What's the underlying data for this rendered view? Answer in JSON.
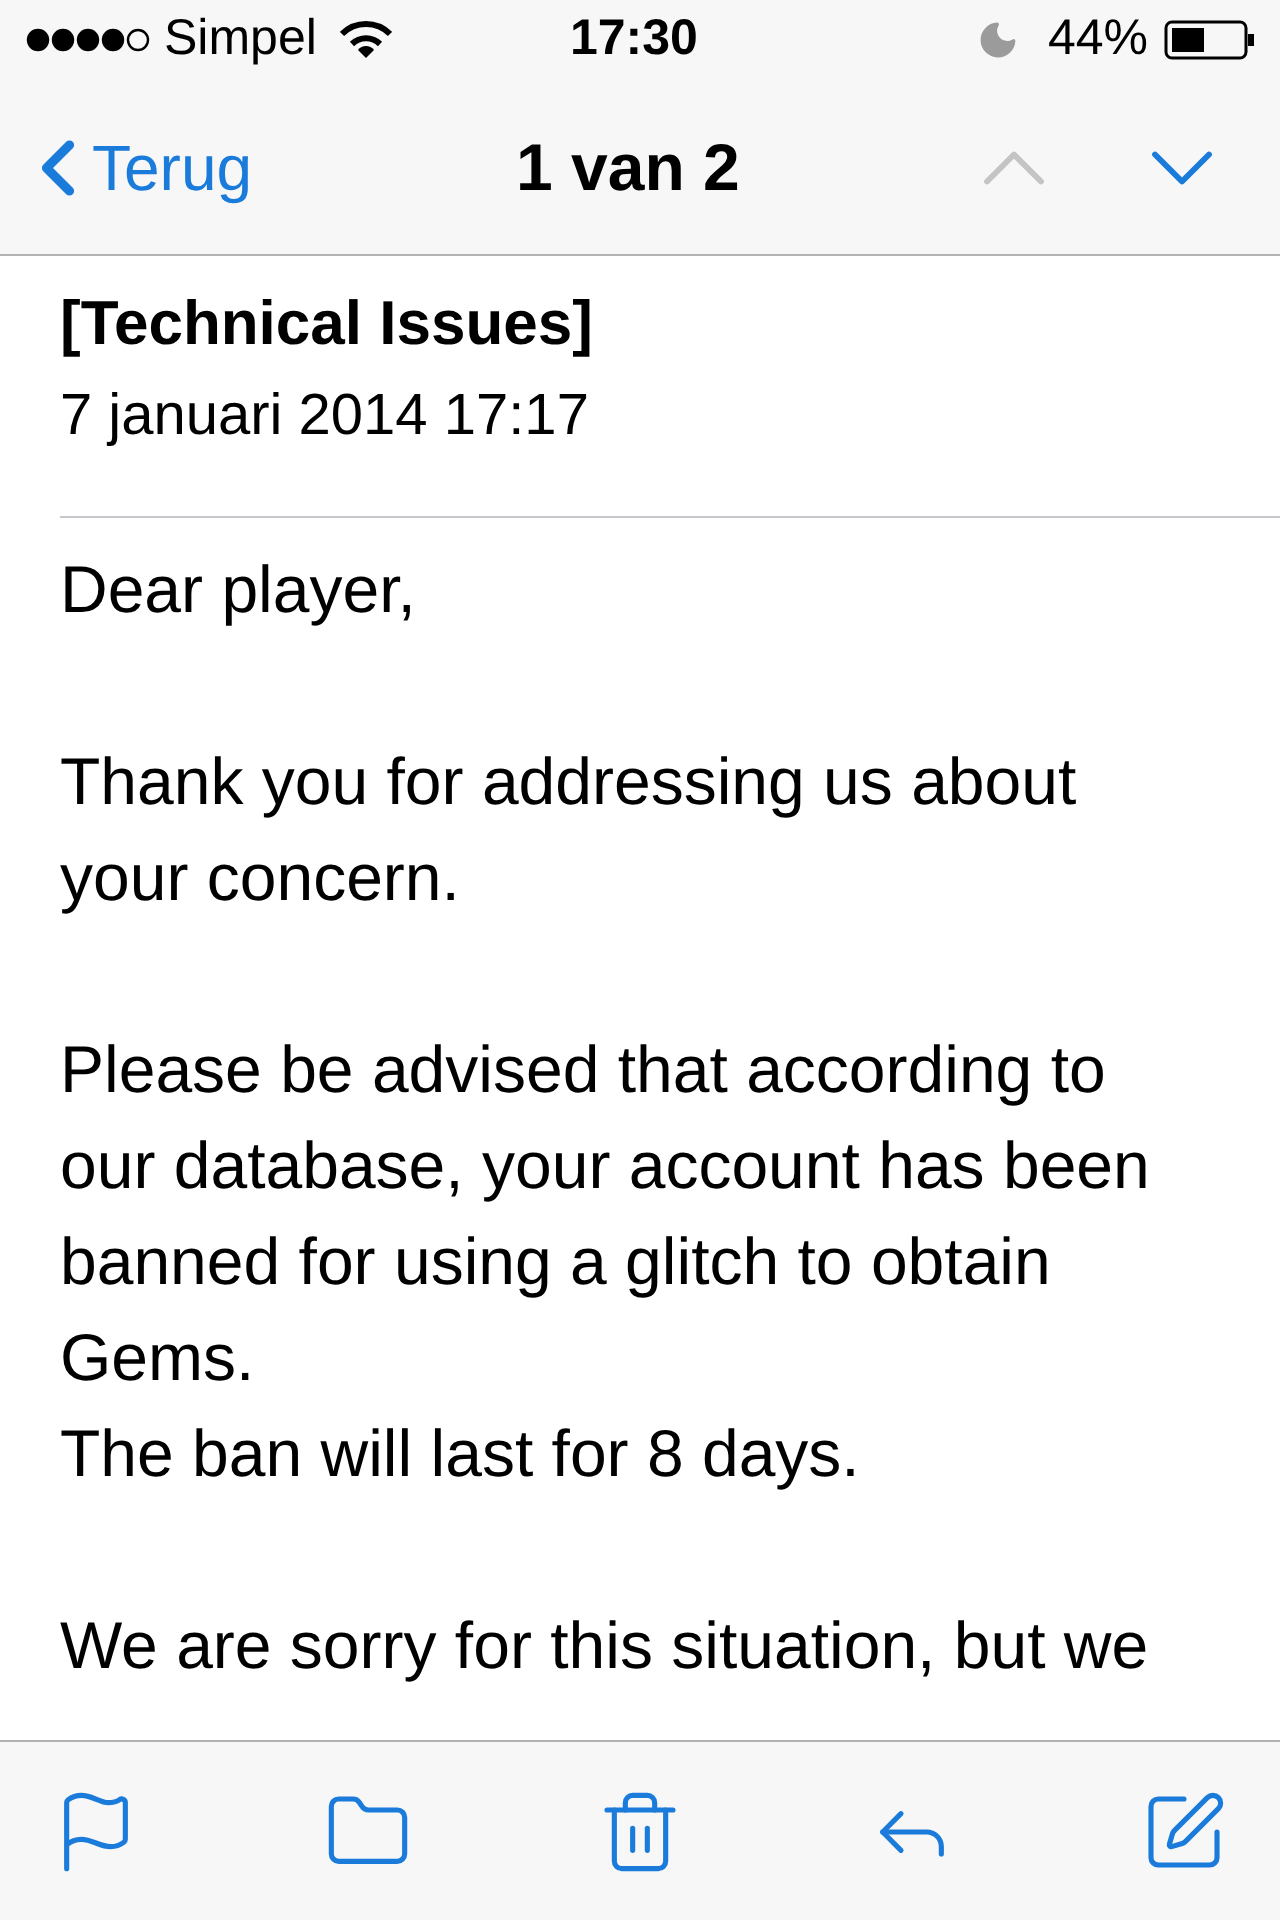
{
  "status_bar": {
    "carrier": "Simpel",
    "time": "17:30",
    "battery": "44%"
  },
  "nav": {
    "back": "Terug",
    "title": "1 van 2",
    "buttons": [
      {
        "kind": "up",
        "disabled": true
      },
      {
        "kind": "down",
        "disabled": false
      }
    ]
  },
  "message": {
    "subject": "[Technical Issues]",
    "date": "7 januari 2014 17:17",
    "paragraphs": [
      [
        "Dear player,"
      ],
      [
        "Thank you for addressing us about your concern."
      ],
      [
        "Please be advised that according to our database, your account has been banned for using a glitch to obtain Gems.",
        "The ban will last for 8 days."
      ],
      [
        "We are sorry for this situation, but we"
      ]
    ]
  },
  "toolbar": {
    "buttons": [
      {
        "kind": "flag"
      },
      {
        "kind": "folder"
      },
      {
        "kind": "trash"
      },
      {
        "kind": "reply"
      },
      {
        "kind": "compose"
      }
    ]
  }
}
